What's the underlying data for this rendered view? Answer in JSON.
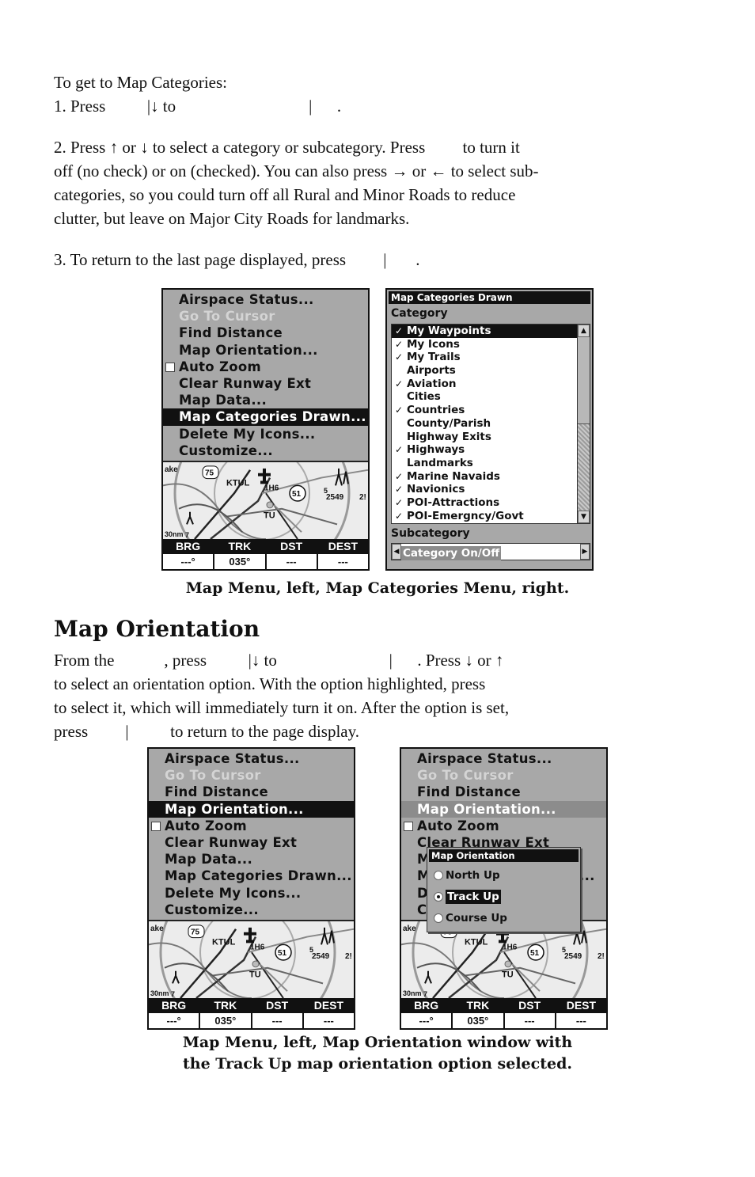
{
  "intro": {
    "heading_line": "To get to Map Categories:",
    "step1": "1. Press          |↓ to                                |      .",
    "step2_lines": [
      "2. Press ↑ or ↓ to select a category or subcategory. Press         to turn it",
      "off (no check) or on (checked). You can also press → or ← to select sub-",
      "categories, so you could turn off all Rural and Minor Roads to reduce",
      "clutter, but leave on Major City Roads for landmarks."
    ],
    "step3": "3. To return to the last page displayed, press         |       ."
  },
  "map_menu": {
    "items": [
      {
        "label": "Airspace Status...",
        "state": "normal"
      },
      {
        "label": "Go To Cursor",
        "state": "disabled"
      },
      {
        "label": "Find Distance",
        "state": "normal"
      },
      {
        "label": "Map Orientation...",
        "state": "normal"
      },
      {
        "label": "Auto Zoom",
        "state": "checkbox-unchecked"
      },
      {
        "label": "Clear Runway Ext",
        "state": "normal"
      },
      {
        "label": "Map Data...",
        "state": "normal"
      },
      {
        "label": "Map Categories Drawn...",
        "state": "normal"
      },
      {
        "label": "Delete My Icons...",
        "state": "normal"
      },
      {
        "label": "Customize...",
        "state": "normal"
      }
    ]
  },
  "map_labels": {
    "lake": "ake",
    "highway_75": "75",
    "airport_ktul": "KTUL",
    "airport_1h6": "1H6",
    "highway_51": "51",
    "airport_tu": "TU",
    "elevation": "2549",
    "partial_5": "5",
    "partial_2": "2!",
    "scale": "30nm",
    "scale_7": "7"
  },
  "data_bar": {
    "headers": [
      "BRG",
      "TRK",
      "DST",
      "DEST"
    ],
    "values": [
      "---°",
      "035°",
      "---",
      "---"
    ]
  },
  "categories_dialog": {
    "title": "Map Categories Drawn",
    "category_label": "Category",
    "items": [
      {
        "label": "My Waypoints",
        "checked": true,
        "selected": true
      },
      {
        "label": "My Icons",
        "checked": true
      },
      {
        "label": "My Trails",
        "checked": true
      },
      {
        "label": "Airports",
        "checked": false
      },
      {
        "label": "Aviation",
        "checked": true
      },
      {
        "label": "Cities",
        "checked": false
      },
      {
        "label": "Countries",
        "checked": true
      },
      {
        "label": "County/Parish",
        "checked": false
      },
      {
        "label": "Highway Exits",
        "checked": false
      },
      {
        "label": "Highways",
        "checked": true
      },
      {
        "label": "Landmarks",
        "checked": false
      },
      {
        "label": "Marine Navaids",
        "checked": true
      },
      {
        "label": "Navionics",
        "checked": true
      },
      {
        "label": "POI-Attractions",
        "checked": true
      },
      {
        "label": "POI-Emergncy/Govt",
        "checked": true
      }
    ],
    "check_glyph": "✓",
    "subcategory_label": "Subcategory",
    "subcategory_value": "Category On/Off"
  },
  "caption1": "Map Menu, left, Map Categories Menu, right.",
  "section": {
    "title": "Map Orientation",
    "lines": [
      "From the            , press          |↓ to                           |      . Press ↓ or ↑",
      "to select an orientation option. With the option highlighted, press",
      "to select it, which will immediately turn it on. After the option is set,",
      "press         |          to return to the page display."
    ]
  },
  "orientation_popup": {
    "title": "Map Orientation",
    "options": [
      {
        "label": "North Up",
        "selected": false
      },
      {
        "label": "Track Up",
        "selected": true
      },
      {
        "label": "Course Up",
        "selected": false
      }
    ],
    "partial_letters": [
      "M",
      "M",
      "D",
      "C"
    ],
    "partial_trailing": "..."
  },
  "caption2": [
    "Map Menu, left, Map Orientation window with",
    "the Track Up map orientation option selected."
  ]
}
